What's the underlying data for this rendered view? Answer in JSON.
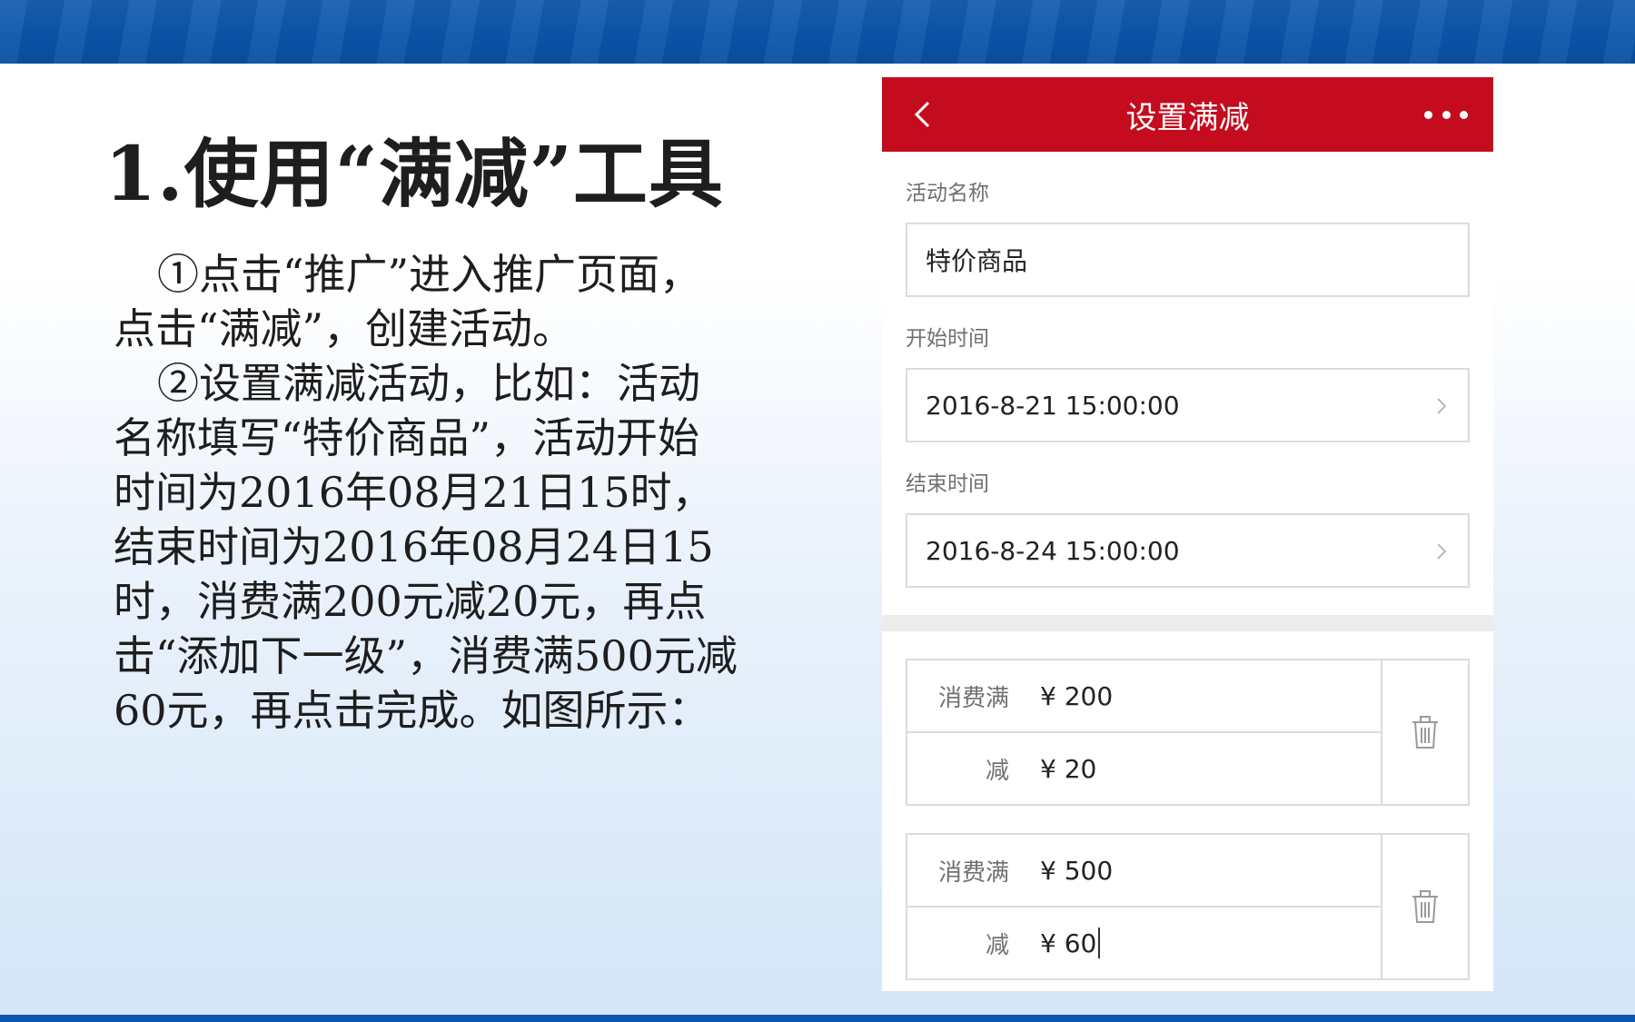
{
  "slide": {
    "title": "1.使用“满减”工具",
    "paragraphs": [
      "①点击“推广”进入推广页面，点击“满减”，创建活动。",
      "②设置满减活动，比如：活动名称填写“特价商品”，活动开始时间为2016年08月21日15时，结束时间为2016年08月24日15时，消费满200元减20元，再点击“添加下一级”，消费满500元减60元，再点击完成。如图所示："
    ]
  },
  "phone": {
    "header": {
      "title": "设置满减",
      "back_icon": "chevron-left-icon",
      "more_icon": "more-horizontal-icon"
    },
    "form": {
      "name_label": "活动名称",
      "name_value": "特价商品",
      "start_label": "开始时间",
      "start_value": "2016-8-21 15:00:00",
      "end_label": "结束时间",
      "end_value": "2016-8-24 15:00:00"
    },
    "tiers": [
      {
        "spend_label": "消费满",
        "spend_value": "¥ 200",
        "minus_label": "减",
        "minus_value": "¥ 20"
      },
      {
        "spend_label": "消费满",
        "spend_value": "¥ 500",
        "minus_label": "减",
        "minus_value": "¥ 60"
      }
    ],
    "delete_icon": "trash-icon"
  },
  "colors": {
    "header_red": "#c40c1e",
    "band_blue": "#0b55ad"
  }
}
